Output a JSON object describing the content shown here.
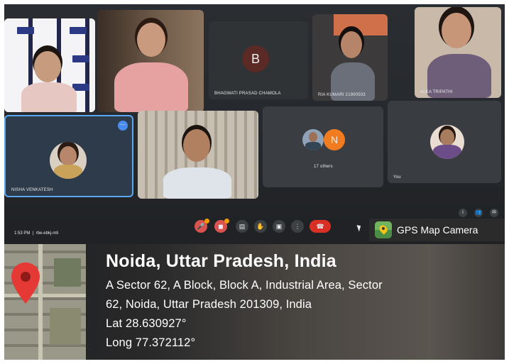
{
  "meeting": {
    "participants": [
      {
        "name": "",
        "tile": "speaker-left"
      },
      {
        "name": "",
        "tile": "speaker-pink"
      },
      {
        "name": "BHAGWATI PRASAD CHAMOLA",
        "avatar_letter": "B"
      },
      {
        "name": "RIA KUMARI 21900503"
      },
      {
        "name": "ALKA TRIPATHI"
      },
      {
        "name": "NISHA VENKATESH"
      },
      {
        "name": ""
      },
      {
        "name": "17 others",
        "badge_letter": "N"
      },
      {
        "name": "You"
      }
    ],
    "time": "1:53 PM",
    "meeting_code": "rbe-ebkj-mti"
  },
  "gps_badge": {
    "label": "GPS Map Camera",
    "icon": "map-camera-icon"
  },
  "location": {
    "title": "Noida, Uttar Pradesh, India",
    "address_line_1": "A Sector 62, A Block, Block A, Industrial Area, Sector",
    "address_line_2": "62, Noida, Uttar Pradesh 201309, India",
    "lat": "Lat 28.630927°",
    "long": "Long 77.372112°",
    "pin_icon": "map-pin-icon",
    "pin_color": "#e53935"
  },
  "colors": {
    "tile_bg": "#3c4043",
    "end_call": "#d93025",
    "accent_border": "#5aa8f0"
  }
}
